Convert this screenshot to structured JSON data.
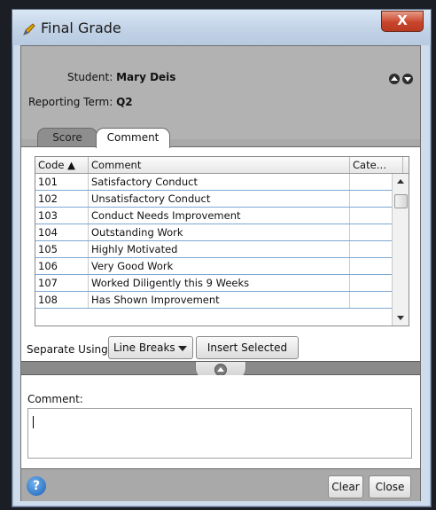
{
  "window": {
    "title": "Final Grade",
    "close_glyph": "X",
    "icon": "pencil-icon"
  },
  "header": {
    "student_label": "Student:",
    "student_name": "Mary Deis",
    "term_label": "Reporting Term:",
    "term_value": "Q2"
  },
  "tabs": [
    {
      "label": "Score",
      "selected": false
    },
    {
      "label": "Comment",
      "selected": true
    }
  ],
  "table": {
    "columns": [
      "Code ▲",
      "Comment",
      "Cate…"
    ],
    "rows": [
      {
        "code": "101",
        "comment": "Satisfactory Conduct",
        "category": ""
      },
      {
        "code": "102",
        "comment": "Unsatisfactory Conduct",
        "category": ""
      },
      {
        "code": "103",
        "comment": "Conduct Needs Improvement",
        "category": ""
      },
      {
        "code": "104",
        "comment": "Outstanding Work",
        "category": ""
      },
      {
        "code": "105",
        "comment": "Highly Motivated",
        "category": ""
      },
      {
        "code": "106",
        "comment": "Very Good Work",
        "category": ""
      },
      {
        "code": "107",
        "comment": "Worked Diligently this 9 Weeks",
        "category": ""
      },
      {
        "code": "108",
        "comment": "Has Shown Improvement",
        "category": ""
      }
    ]
  },
  "controls": {
    "separate_label": "Separate Using",
    "separate_value": "Line Breaks",
    "insert_label": "Insert Selected"
  },
  "comment": {
    "label": "Comment:",
    "value": ""
  },
  "footer": {
    "help_glyph": "?",
    "clear_label": "Clear",
    "close_label": "Close"
  },
  "colors": {
    "row_line": "#7da7d1",
    "frame": "#a9a9a9",
    "accent": "#1c62b8"
  }
}
